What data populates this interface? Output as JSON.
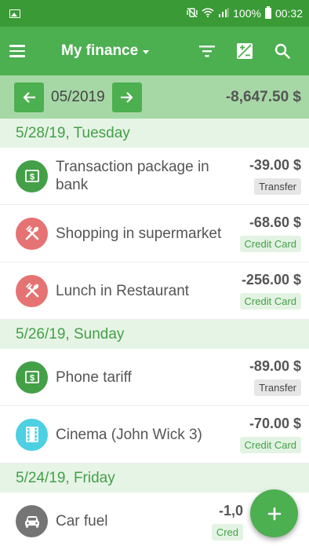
{
  "status_bar": {
    "battery_text": "100%",
    "time": "00:32",
    "icons": [
      "image-icon",
      "mute-vibrate-icon",
      "wifi-icon",
      "signal-icon",
      "battery-icon"
    ]
  },
  "app_bar": {
    "title": "My finance",
    "actions": [
      "filter-icon",
      "balance-icon",
      "search-icon"
    ]
  },
  "month_bar": {
    "month": "05/2019",
    "total": "-8,647.50 $"
  },
  "colors": {
    "primary": "#4caf50",
    "status_bar": "#3a9a36",
    "month_bar": "#a6d8a6",
    "section_bg": "#e6f4e6",
    "section_text": "#43a047",
    "cat_finance": "#43a047",
    "cat_food": "#e57373",
    "cat_cinema": "#4dd0e1",
    "cat_car": "#757575"
  },
  "sections": [
    {
      "date": "5/28/19, Tuesday",
      "items": [
        {
          "icon": "cash-icon",
          "title": "Transaction package in bank",
          "amount": "-39.00 $",
          "tag": "Transfer"
        },
        {
          "icon": "cutlery-icon",
          "title": "Shopping in supermarket",
          "amount": "-68.60 $",
          "tag": "Credit Card"
        },
        {
          "icon": "cutlery-icon",
          "title": "Lunch in Restaurant",
          "amount": "-256.00 $",
          "tag": "Credit Card"
        }
      ]
    },
    {
      "date": "5/26/19, Sunday",
      "items": [
        {
          "icon": "cash-icon",
          "title": "Phone tariff",
          "amount": "-89.00 $",
          "tag": "Transfer"
        },
        {
          "icon": "film-icon",
          "title": "Cinema (John Wick 3)",
          "amount": "-70.00 $",
          "tag": "Credit Card"
        }
      ]
    },
    {
      "date": "5/24/19, Friday",
      "items": [
        {
          "icon": "car-icon",
          "title": "Car fuel",
          "amount": "-1,0",
          "tag": "Cred"
        }
      ]
    }
  ],
  "fab": {
    "icon": "plus-icon"
  }
}
